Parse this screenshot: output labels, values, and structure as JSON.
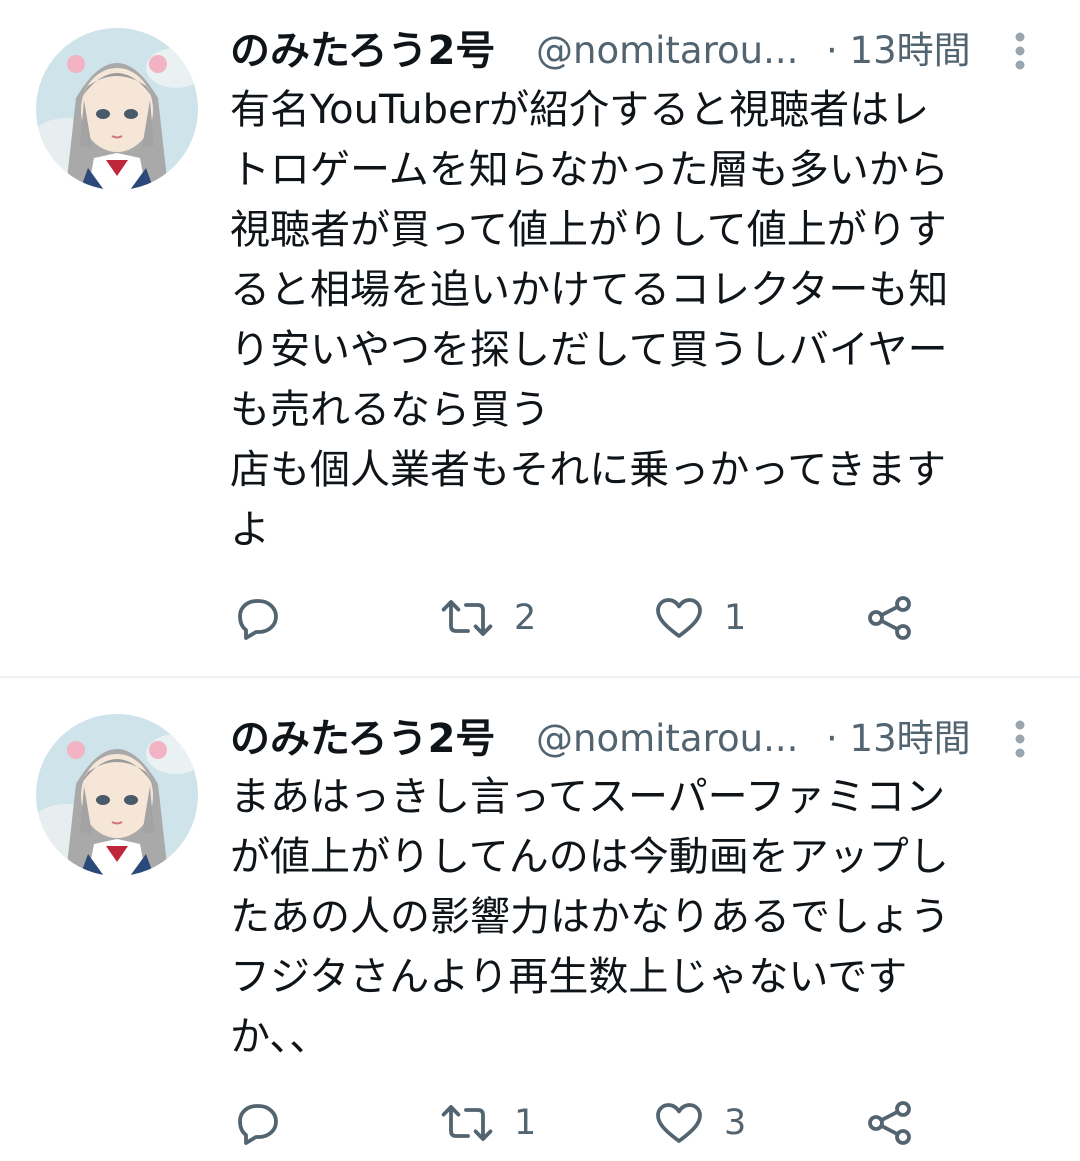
{
  "tweets": [
    {
      "display_name": "のみたろう2号",
      "handle": "@nomitarou...",
      "timestamp": "· 13時間",
      "avatar_icon": "anime-girl-avatar",
      "text_lines": [
        "有名YouTuberが紹介すると視聴者はレ",
        "トロゲームを知らなかった層も多いから",
        "視聴者が買って値上がりして値上がりす",
        "ると相場を追いかけてるコレクターも知",
        "り安いやつを探しだして買うしバイヤー",
        "も売れるなら買う",
        "店も個人業者もそれに乗っかってきます",
        "よ"
      ],
      "reply_count": "",
      "retweet_count": "2",
      "like_count": "1"
    },
    {
      "display_name": "のみたろう2号",
      "handle": "@nomitarou...",
      "timestamp": "· 13時間",
      "avatar_icon": "anime-girl-avatar",
      "text_lines": [
        "まあはっきし言ってスーパーファミコン",
        "が値上がりしてんのは今動画をアップし",
        "たあの人の影響力はかなりあるでしょう",
        "フジタさんより再生数上じゃないです",
        "か、、"
      ],
      "reply_count": "",
      "retweet_count": "1",
      "like_count": "3"
    }
  ],
  "colors": {
    "text_primary": "#0f1419",
    "text_secondary": "#536471",
    "divider": "#eff3f4"
  },
  "icons": [
    "reply-icon",
    "retweet-icon",
    "like-icon",
    "share-icon",
    "more-icon"
  ]
}
